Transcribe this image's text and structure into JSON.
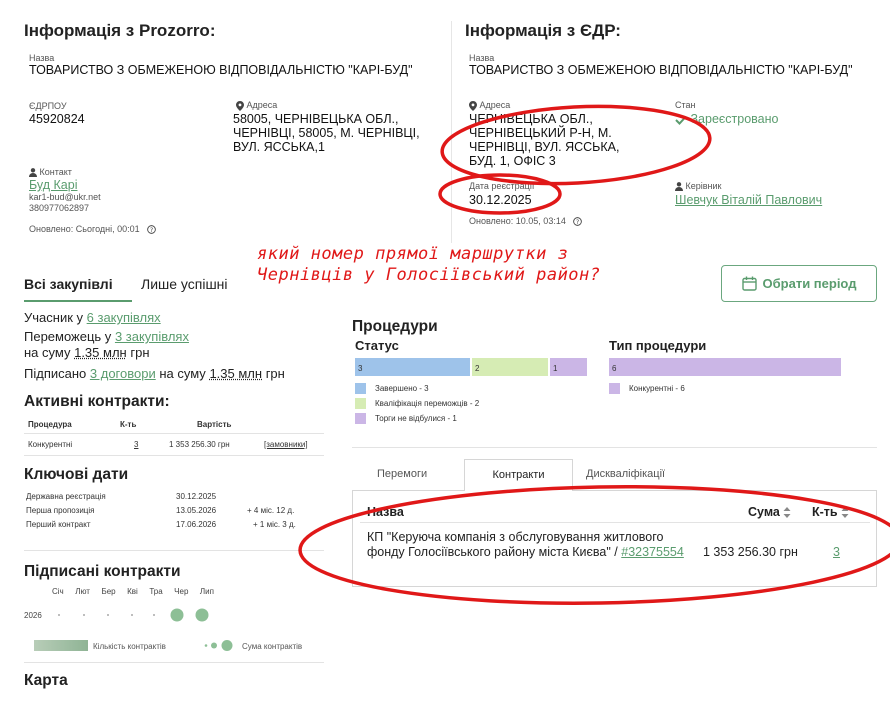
{
  "prozorro": {
    "title": "Інформація з Prozorro:",
    "name_label": "Назва",
    "name_value": "ТОВАРИСТВО З ОБМЕЖЕНОЮ ВІДПОВІДАЛЬНІСТЮ \"КАРІ-БУД\"",
    "edrpou_label": "ЄДРПОУ",
    "edrpou_value": "45920824",
    "address_label": "Адреса",
    "address_value": "58005, ЧЕРНІВЕЦЬКА ОБЛ., ЧЕРНІВЦІ, 58005, М. ЧЕРНІВЦІ, ВУЛ. ЯССЬКА,1",
    "contact_label": "Контакт",
    "contact_name": "Буд Карі",
    "contact_email": "kar1-bud@ukr.net",
    "contact_phone": "380977062897",
    "updated": "Оновлено: Сьогодні, 00:01"
  },
  "edr": {
    "title": "Інформація з ЄДР:",
    "name_label": "Назва",
    "name_value": "ТОВАРИСТВО З ОБМЕЖЕНОЮ ВІДПОВІДАЛЬНІСТЮ \"КАРІ-БУД\"",
    "address_label": "Адреса",
    "address_value": "ЧЕРНІВЕЦЬКА ОБЛ., ЧЕРНІВЕЦЬКИЙ Р-Н, М. ЧЕРНІВЦІ, ВУЛ. ЯССЬКА, БУД. 1, ОФІС 3",
    "status_label": "Стан",
    "status_value": "Зареєстровано",
    "reg_date_label": "Дата реєстрації",
    "reg_date_value": "30.12.2025",
    "head_label": "Керівник",
    "head_value": "Шевчук Віталій Павлович",
    "updated": "Оновлено: 10.05, 03:14"
  },
  "overlay_question": "який номер прямої маршрутки з Чернівців у Голосіївський район?",
  "tabs": {
    "all": "Всі закупівлі",
    "success": "Лише успішні"
  },
  "period_button": "Обрати період",
  "summary": {
    "participant_pre": "Учасник у",
    "participant_link": "6 закупівлях",
    "winner_pre": "Переможець у",
    "winner_link": "3 закупівлях",
    "winner_sum_pre": "на суму",
    "winner_sum": "1.35 млн",
    "currency": "грн",
    "signed_pre": "Підписано",
    "signed_link": "3 договори",
    "signed_sum_pre": "на суму",
    "signed_sum": "1.35 млн",
    "signed_currency": "грн"
  },
  "active_contracts": {
    "title": "Активні контракти:",
    "headers": [
      "Процедура",
      "К-ть",
      "Вартість"
    ],
    "row": {
      "procedure": "Конкурентні",
      "count": "3",
      "value": "1 353 256.30 грн",
      "link": "[замовники]"
    }
  },
  "key_dates": {
    "title": "Ключові дати",
    "rows": [
      {
        "label": "Державна реєстрація",
        "date": "30.12.2025",
        "delta": ""
      },
      {
        "label": "Перша пропозиція",
        "date": "13.05.2026",
        "delta": "+ 4 міс. 12 д."
      },
      {
        "label": "Перший контракт",
        "date": "17.06.2026",
        "delta": "+ 1 міс. 3 д."
      }
    ]
  },
  "signed_contracts": {
    "title": "Підписані контракти",
    "months": [
      "Січ",
      "Лют",
      "Бер",
      "Кві",
      "Тра",
      "Чер",
      "Лип"
    ],
    "year": "2026",
    "legend_count": "Кількість контрактів",
    "legend_sum": "Сума контрактів"
  },
  "map_title": "Карта",
  "procedures": {
    "title": "Процедури",
    "status_title": "Статус",
    "type_title": "Тип процедури",
    "status_bars": [
      {
        "value": "3",
        "color": "#9ec3ea"
      },
      {
        "value": "2",
        "color": "#d6ecb4"
      },
      {
        "value": "1",
        "color": "#cbb6e6"
      }
    ],
    "status_legend": [
      {
        "label": "Завершено - 3",
        "color": "#9ec3ea"
      },
      {
        "label": "Кваліфікація переможців - 2",
        "color": "#d6ecb4"
      },
      {
        "label": "Торги не відбулися - 1",
        "color": "#cbb6e6"
      }
    ],
    "type_bar": {
      "value": "6",
      "color": "#cbb6e6"
    },
    "type_legend": [
      {
        "label": "Конкурентні - 6",
        "color": "#cbb6e6"
      }
    ]
  },
  "lower_tabs": {
    "wins": "Перемоги",
    "contracts": "Контракти",
    "disq": "Дискваліфікації"
  },
  "contracts_table": {
    "h_name": "Назва",
    "h_sum": "Сума",
    "h_count": "К-ть",
    "row_name": "КП \"Керуюча компанія з обслуговування житлового фонду Голосіївського району міста Києва\" /",
    "row_link": "#32375554",
    "row_sum": "1 353 256.30 грн",
    "row_count": "3"
  },
  "colors": {
    "accent": "#5a9c6e",
    "annotation": "#e01818"
  }
}
